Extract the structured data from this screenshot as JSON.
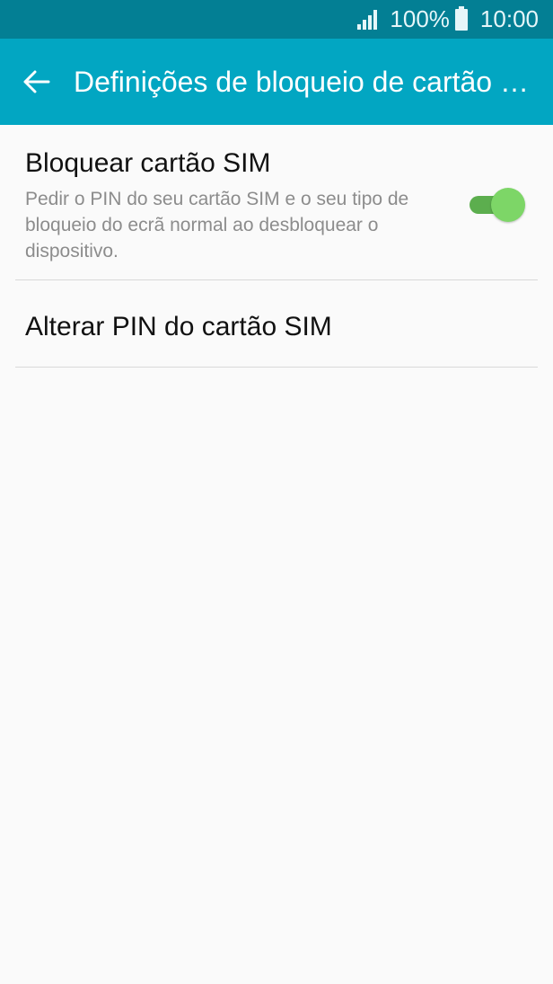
{
  "status_bar": {
    "battery": "100%",
    "time": "10:00",
    "icons": [
      "signal-icon",
      "battery-icon"
    ]
  },
  "app_bar": {
    "back_icon": "arrow-left-icon",
    "title": "Definições de bloqueio de cartão SIM"
  },
  "settings": [
    {
      "title": "Bloquear cartão SIM",
      "subtitle": "Pedir o PIN do seu cartão SIM e o seu tipo de bloqueio do ecrã normal ao desbloquear o dispositivo.",
      "toggle_on": true
    },
    {
      "title": "Alterar PIN do cartão SIM"
    }
  ],
  "colors": {
    "status_bar": "#037f94",
    "app_bar": "#02a6c2",
    "toggle_track": "#5cae4e",
    "toggle_thumb": "#7dd667"
  }
}
